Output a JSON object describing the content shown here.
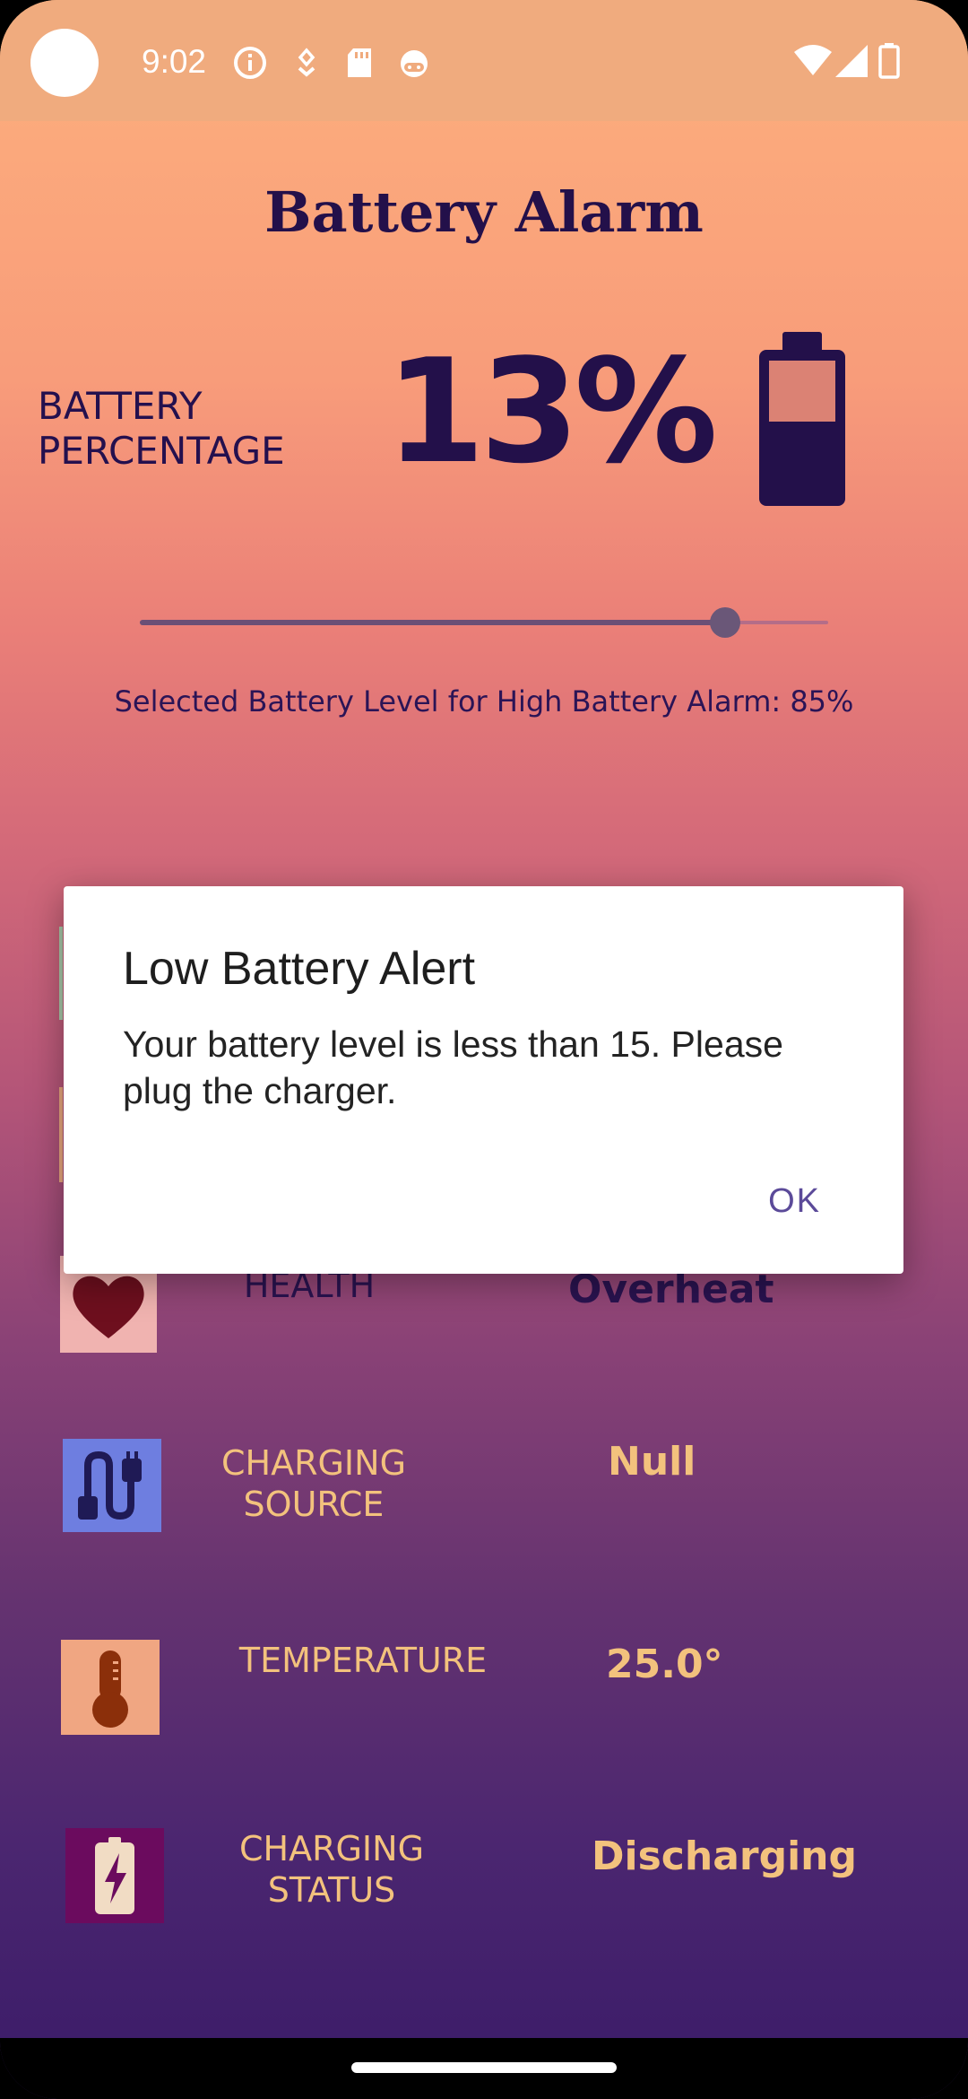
{
  "status_bar": {
    "time": "9:02",
    "left_icons": [
      "info-icon",
      "download-icon",
      "sd-card-icon",
      "android-head-icon"
    ],
    "right_icons": [
      "wifi-icon",
      "cell-signal-icon",
      "battery-icon"
    ]
  },
  "header": {
    "title": "Battery Alarm"
  },
  "battery": {
    "label": "BATTERY PERCENTAGE",
    "percentage": "13%",
    "icon": "battery-low-icon"
  },
  "slider": {
    "value_fraction": 0.85,
    "caption": "Selected Battery Level for High Battery Alarm: 85%"
  },
  "rows": {
    "health": {
      "label": "HEALTH",
      "value": "Overheat",
      "icon": "heart-icon"
    },
    "charging_source": {
      "label": "CHARGING SOURCE",
      "value": "Null",
      "icon": "charging-cable-icon"
    },
    "temperature": {
      "label": "TEMPERATURE",
      "value": "25.0°",
      "icon": "thermometer-icon"
    },
    "charging_status": {
      "label": "CHARGING STATUS",
      "value": "Discharging",
      "icon": "battery-charging-icon"
    }
  },
  "dialog": {
    "title": "Low Battery Alert",
    "message": "Your battery level is less than 15. Please plug the charger.",
    "ok_label": "OK"
  },
  "colors": {
    "primary_text": "#23104a",
    "accent_yellow": "#f3c27d",
    "dialog_button": "#5b4a99"
  }
}
